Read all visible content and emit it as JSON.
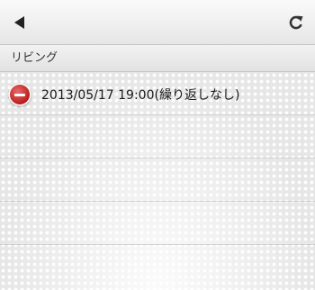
{
  "toolbar": {
    "back_icon": "back-arrow-icon",
    "refresh_icon": "refresh-icon"
  },
  "section": {
    "title": "リビング"
  },
  "schedule": {
    "items": [
      {
        "label": "2013/05/17 19:00(繰り返しなし)",
        "icon": "remove-icon"
      }
    ]
  },
  "colors": {
    "remove_icon": "#c62828",
    "text": "#1a1a1a"
  }
}
